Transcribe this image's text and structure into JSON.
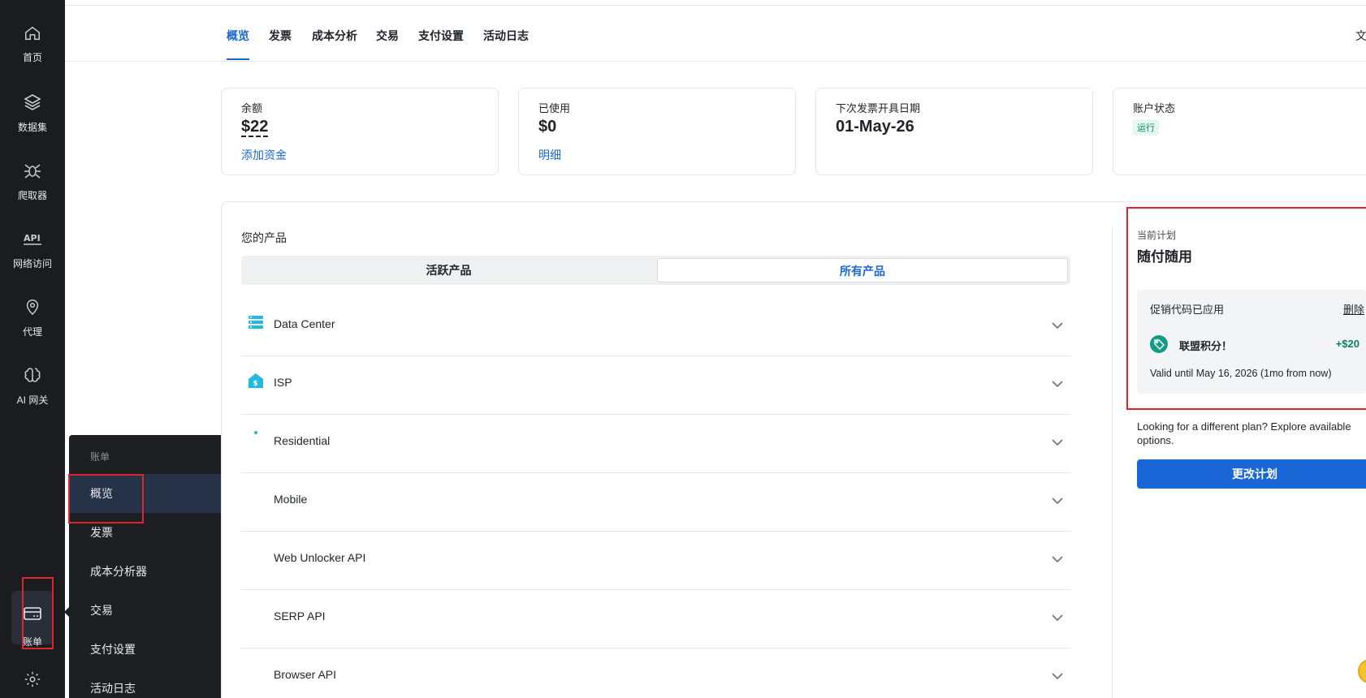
{
  "rail": {
    "items": [
      {
        "label": "首页",
        "icon": "home-icon"
      },
      {
        "label": "数据集",
        "icon": "layers-icon"
      },
      {
        "label": "爬取器",
        "icon": "spider-icon"
      },
      {
        "label": "网络访问",
        "icon": "api-icon"
      },
      {
        "label": "代理",
        "icon": "location-pin-icon"
      },
      {
        "label": "AI 网关",
        "icon": "brain-icon"
      }
    ],
    "billing": {
      "label": "账单",
      "icon": "credit-card-icon"
    },
    "settings": {
      "icon": "gear-icon"
    }
  },
  "flyout": {
    "heading": "账单",
    "items": [
      "概览",
      "发票",
      "成本分析器",
      "交易",
      "支付设置",
      "活动日志"
    ],
    "active_index": 0
  },
  "tabs": {
    "items": [
      "概览",
      "发票",
      "成本分析",
      "交易",
      "支付设置",
      "活动日志"
    ],
    "active_index": 0,
    "cut_text": "文"
  },
  "cards": {
    "balance": {
      "title": "余额",
      "value": "$22",
      "link": "添加资金"
    },
    "used": {
      "title": "已使用",
      "value": "$0",
      "link": "明细"
    },
    "next_invoice": {
      "title": "下次发票开具日期",
      "value": "01-May-26"
    },
    "status": {
      "title": "账户状态",
      "badge": "运行"
    }
  },
  "products": {
    "title": "您的产品",
    "segment": {
      "active": "活跃产品",
      "all": "所有产品",
      "selected": "all"
    },
    "items": [
      {
        "name": "Data Center",
        "icon": "server-stack-icon"
      },
      {
        "name": "ISP",
        "icon": "isp-house-icon"
      },
      {
        "name": "Residential",
        "icon": "residential-icon"
      },
      {
        "name": "Mobile",
        "icon": "mobile-icon"
      },
      {
        "name": "Web Unlocker API",
        "icon": "unlocker-icon"
      },
      {
        "name": "SERP API",
        "icon": "serp-icon"
      },
      {
        "name": "Browser API",
        "icon": "browser-icon"
      }
    ]
  },
  "plan": {
    "label": "当前计划",
    "name": "随付随用",
    "promo": {
      "title": "促销代码已应用",
      "delete": "删除",
      "name": "联盟积分！",
      "amount": "+$20",
      "valid": "Valid until May 16, 2026 (1mo from now)"
    },
    "explore": "Looking for a different plan? Explore available options.",
    "change_button": "更改计划"
  },
  "colors": {
    "accent": "#1a66d6",
    "rail_bg": "#1b1c1f",
    "highlight": "#e0242b",
    "success": "#0b8a6b"
  }
}
